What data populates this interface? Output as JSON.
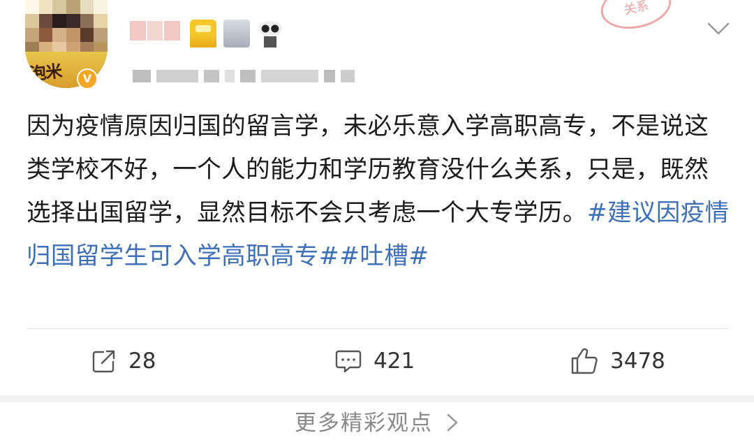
{
  "header": {
    "avatar_text": "泡米",
    "verified_badge": "V",
    "stamp_text": "关系",
    "menu_icon": "chevron-down-icon"
  },
  "post": {
    "text": "因为疫情原因归国的留言学，未必乐意入学高职高专，不是说这类学校不好，一个人的能力和学历教育没什么关系，只是，既然选择出国留学，显然目标不会只考虑一个大专学历。",
    "topics": [
      "#建议因疫情归国留学生可入学高职高专#",
      "#吐槽#"
    ]
  },
  "actions": {
    "share": {
      "icon": "share-icon",
      "count": "28"
    },
    "comment": {
      "icon": "comment-icon",
      "count": "421"
    },
    "like": {
      "icon": "thumbs-up-icon",
      "count": "3478"
    }
  },
  "footer": {
    "more_label": "更多精彩观点"
  },
  "colors": {
    "topic_link": "#3e70b9",
    "text": "#1c1c1c",
    "muted": "#8a8a8a",
    "divider": "#e6e6e6"
  }
}
